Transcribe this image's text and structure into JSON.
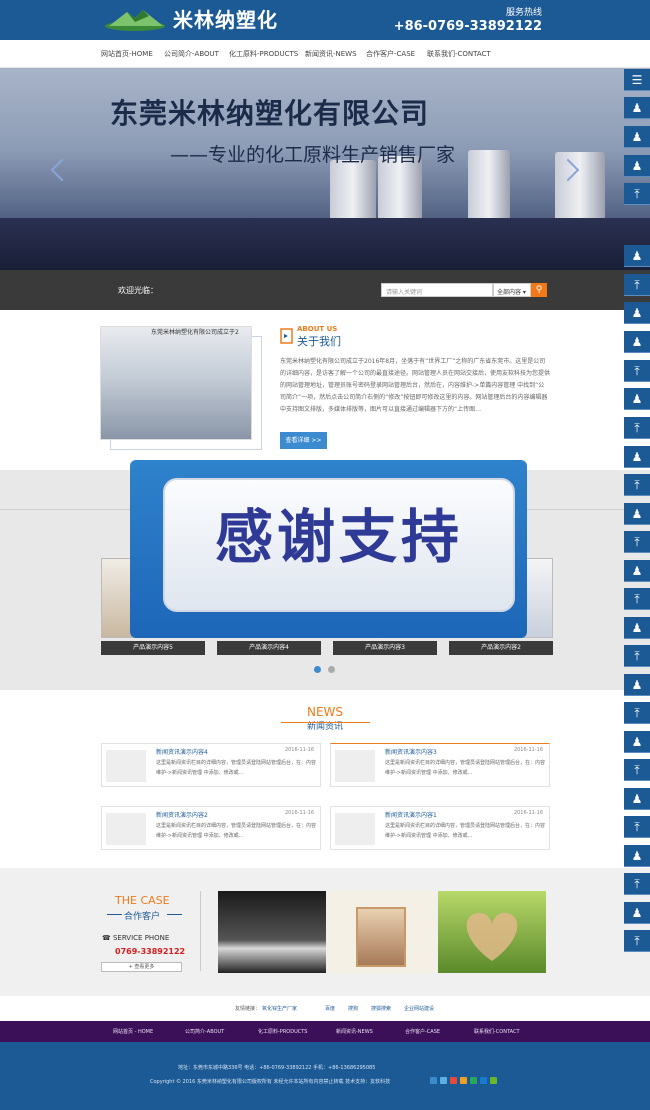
{
  "header": {
    "logo_text": "米林纳塑化",
    "hotline_label": "服务热线",
    "hotline_number": "+86-0769-33892122"
  },
  "nav": [
    "网站首页-HOME",
    "公司简介-ABOUT",
    "化工原料-PRODUCTS",
    "新闻资讯-NEWS",
    "合作客户-CASE",
    "联系我们-CONTACT"
  ],
  "banner": {
    "title": "东莞米林纳塑化有限公司",
    "subtitle": "——专业的化工原料生产销售厂家"
  },
  "search": {
    "welcome": "欢迎光临：",
    "placeholder": "请输入关键词",
    "select_value": "全部内容 ▾",
    "button_icon": "search-icon"
  },
  "about": {
    "image_caption": "东莞米林纳塑化有限公司成立于2",
    "en": "ABOUT US",
    "cn": "关于我们",
    "body": "东莞米林纳塑化有限公司成立于2016年8月，坐落于有“世界工厂”之称的广东省东莞市。这里是公司的详细内容，是访客了解一个公司的最直接途径。网站管理人员在网站交接后，使用友软科技为您提供的网站管理地址，管理员账号密码登录网站管理后台，然后在，内容维护->单篇内容管理 中找到“公司简介”一项，然后点击公司简介右侧的“修改”按钮即可修改这里的内容。网站管理后台的内容编辑器中支持图文排版，多媒体排版等，图片可以直接通过编辑器下方的“上传图…",
    "more": "查看详细 >>"
  },
  "products": {
    "labels": [
      "产品演示内容5",
      "产品演示内容4",
      "产品演示内容3",
      "产品演示内容2"
    ]
  },
  "popup": {
    "text": "感谢支持"
  },
  "news": {
    "en": "NEWS",
    "cn": "新闻资讯",
    "items": [
      {
        "title": "新闻资讯演示内容4",
        "date": "2016-11-16",
        "summary": "这里是新闻资讯栏目的详细内容，管理员请登陆网站管理后台，在：内容维护->新闻资讯管理 中添加、修改或..."
      },
      {
        "title": "新闻资讯演示内容3",
        "date": "2016-11-16",
        "summary": "这里是新闻资讯栏目的详细内容，管理员请登陆网站管理后台，在：内容维护->新闻资讯管理 中添加、修改或..."
      },
      {
        "title": "新闻资讯演示内容2",
        "date": "2016-11-16",
        "summary": "这里是新闻资讯栏目的详细内容，管理员请登陆网站管理后台，在：内容维护->新闻资讯管理 中添加、修改或..."
      },
      {
        "title": "新闻资讯演示内容1",
        "date": "2016-11-16",
        "summary": "这里是新闻资讯栏目的详细内容，管理员请登陆网站管理后台，在：内容维护->新闻资讯管理 中添加、修改或..."
      }
    ]
  },
  "cases": {
    "en": "THE CASE",
    "cn": "合作客户",
    "service": "SERVICE PHONE",
    "phone": "0769-33892122",
    "more": "+ 查看更多",
    "images": [
      "mountain-photo",
      "portrait-photo",
      "heart-photo"
    ]
  },
  "links": {
    "label": "友情链接：",
    "items": [
      "氧化锌生产厂家",
      "百度",
      "搜狗",
      "搜狐搜索",
      "企业网站建设"
    ]
  },
  "footer_nav": [
    "网站首页 - HOME",
    "公司简介-ABOUT",
    "化工原料-PRODUCTS",
    "新闻资讯-NEWS",
    "合作客户-CASE",
    "联系我们-CONTACT"
  ],
  "footer": {
    "line1": "地址：东莞市东城中路336号      电话：+86-0769-33892122      手机：+86-13686295085",
    "line2": "Copyright © 2016 东莞米林纳塑化有限公司版权所有 未经允许本站所有内容禁止转载    技术支持：友软科技"
  },
  "colors": {
    "primary": "#1c5a96",
    "accent": "#f07a1a",
    "footer_nav": "#3c1058"
  }
}
